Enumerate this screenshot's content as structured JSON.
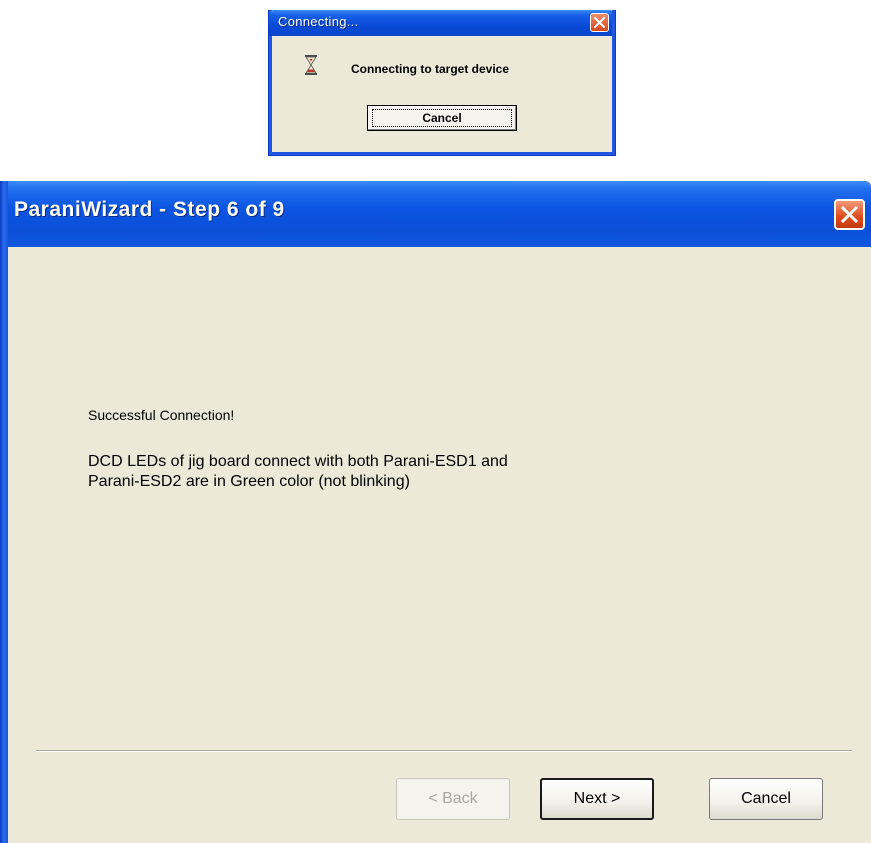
{
  "connecting_dialog": {
    "title": "Connecting...",
    "message": "Connecting to target device",
    "cancel_label": "Cancel",
    "icon": "hourglass-icon"
  },
  "wizard": {
    "title": "ParaniWizard - Step 6 of 9",
    "message_status": "Successful Connection!",
    "message_detail": "DCD LEDs of jig board connect with both Parani-ESD1 and\nParani-ESD2 are in Green color (not blinking)",
    "buttons": {
      "back_label": "< Back",
      "next_label": "Next >",
      "cancel_label": "Cancel"
    },
    "back_enabled": false
  },
  "colors": {
    "titlebar_blue": "#0a4fd8",
    "window_face": "#ece9d8",
    "close_red": "#dd4a1c"
  }
}
